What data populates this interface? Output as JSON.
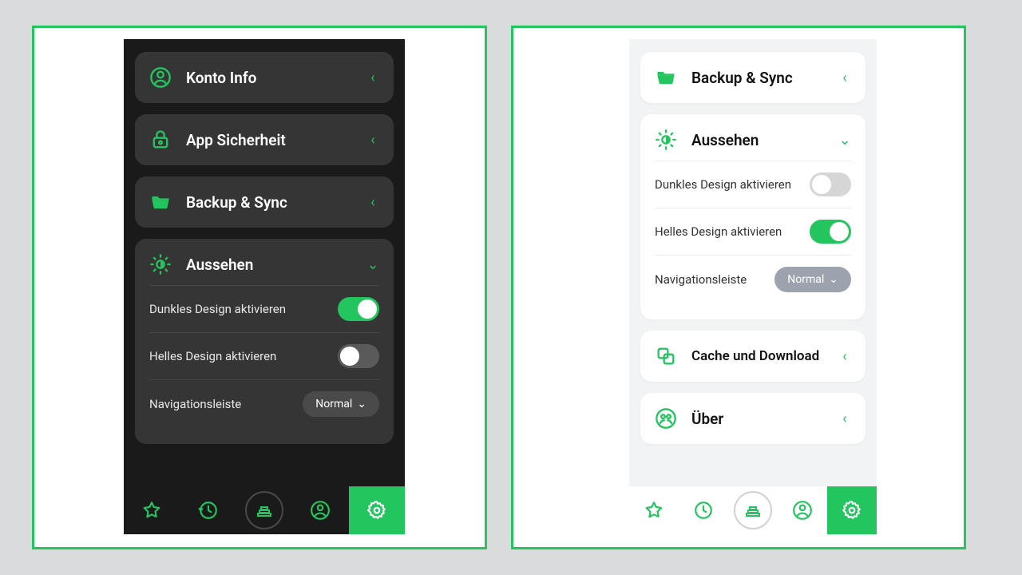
{
  "accent": "#22c55e",
  "dark": {
    "items": [
      {
        "label": "Konto Info"
      },
      {
        "label": "App Sicherheit"
      },
      {
        "label": "Backup & Sync"
      }
    ],
    "appearance": {
      "label": "Aussehen",
      "dark_enable": "Dunkles Design aktivieren",
      "light_enable": "Helles Design aktivieren",
      "navbar": "Navigationsleiste",
      "navbar_value": "Normal"
    }
  },
  "light": {
    "items": [
      {
        "label": "Backup & Sync"
      }
    ],
    "appearance": {
      "label": "Aussehen",
      "dark_enable": "Dunkles Design aktivieren",
      "light_enable": "Helles Design aktivieren",
      "navbar": "Navigationsleiste",
      "navbar_value": "Normal"
    },
    "extra": [
      {
        "label": "Cache und Download"
      },
      {
        "label": "Über"
      }
    ]
  }
}
